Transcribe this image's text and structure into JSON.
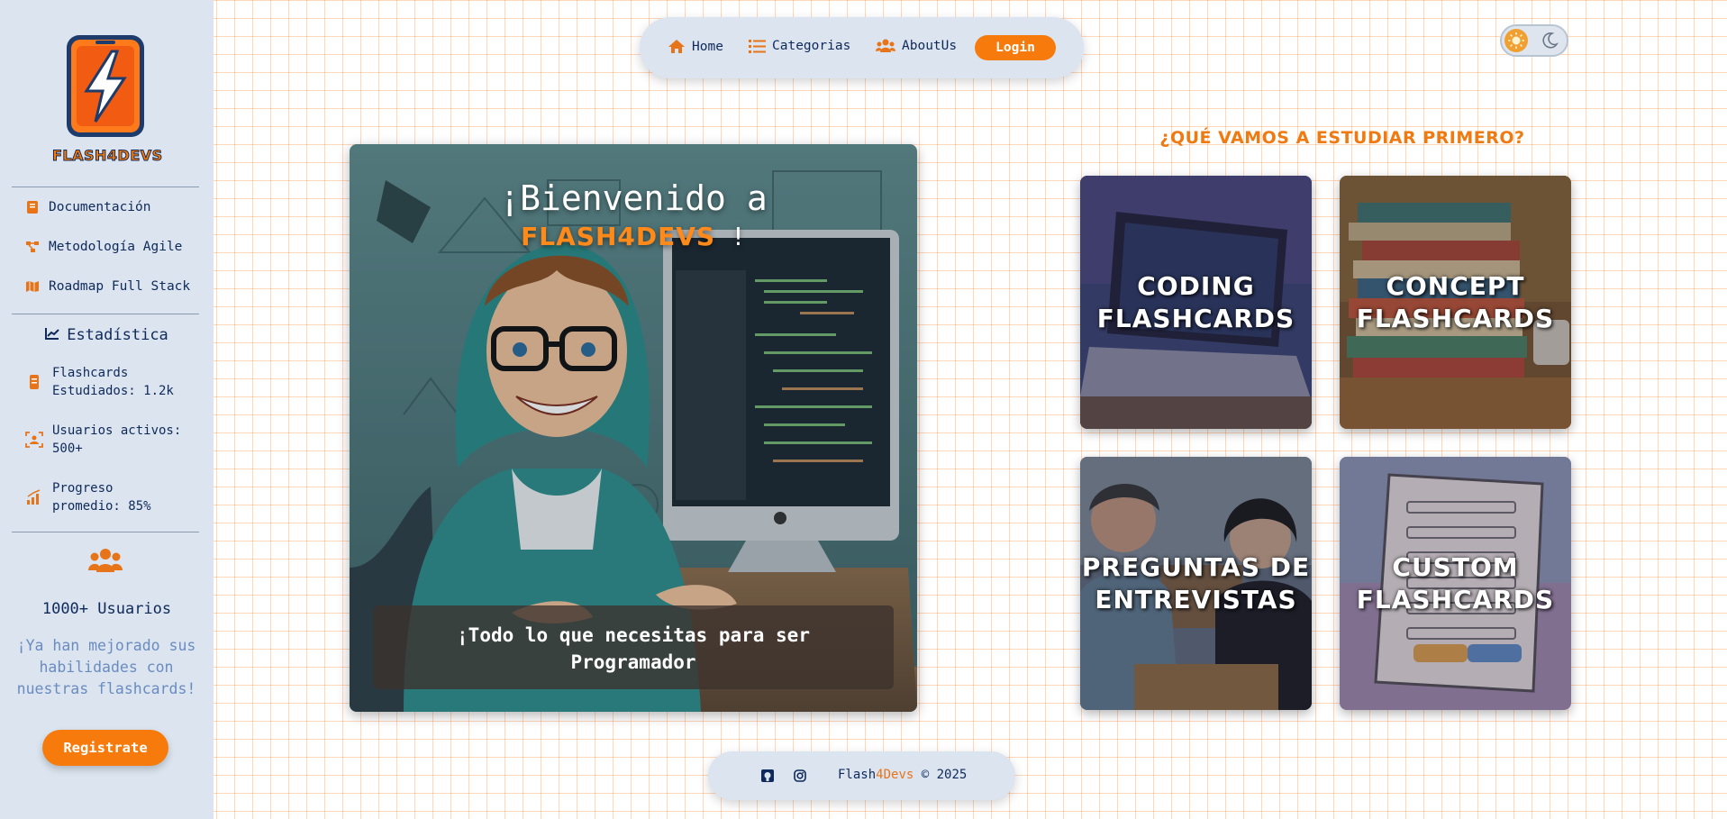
{
  "sidebar": {
    "logo_text": "FLASH4DEVS",
    "links": [
      {
        "label": "Documentación",
        "icon": "book-icon"
      },
      {
        "label": "Metodología Agile",
        "icon": "workflow-icon"
      },
      {
        "label": "Roadmap Full Stack",
        "icon": "map-icon"
      }
    ],
    "stats_title": "Estadística",
    "stats": [
      {
        "label": "Flashcards Estudiados: 1.2k",
        "icon": "cards-icon"
      },
      {
        "label": "Usuarios activos: 500+",
        "icon": "users-scan-icon"
      },
      {
        "label": "Progreso promedio: 85%",
        "icon": "bar-chart-icon"
      }
    ],
    "users_count": "1000+ Usuarios",
    "users_message": "¡Ya han mejorado sus habilidades con nuestras flashcards!",
    "register_label": "Registrate"
  },
  "nav": {
    "home": "Home",
    "categories": "Categorias",
    "about": "AboutUs",
    "login": "Login"
  },
  "hero": {
    "title_line1": "¡Bienvenido a",
    "brand": "FLASH4DEVS",
    "title_suffix": " !",
    "subtitle": "¡Todo lo que necesitas para ser Programador"
  },
  "study": {
    "title": "¿QUÉ VAMOS A ESTUDIAR PRIMERO?",
    "cards": [
      {
        "label": "CODING FLASHCARDS"
      },
      {
        "label": "CONCEPT FLASHCARDS"
      },
      {
        "label": "PREGUNTAS DE ENTREVISTAS"
      },
      {
        "label": "CUSTOM FLASHCARDS"
      }
    ]
  },
  "footer": {
    "brand_a": "Flash",
    "brand_b": "4Devs",
    "copyright": " © 2025"
  },
  "colors": {
    "accent": "#f77b0c",
    "navy": "#0f2a5a",
    "panel": "#dbe4ef"
  }
}
